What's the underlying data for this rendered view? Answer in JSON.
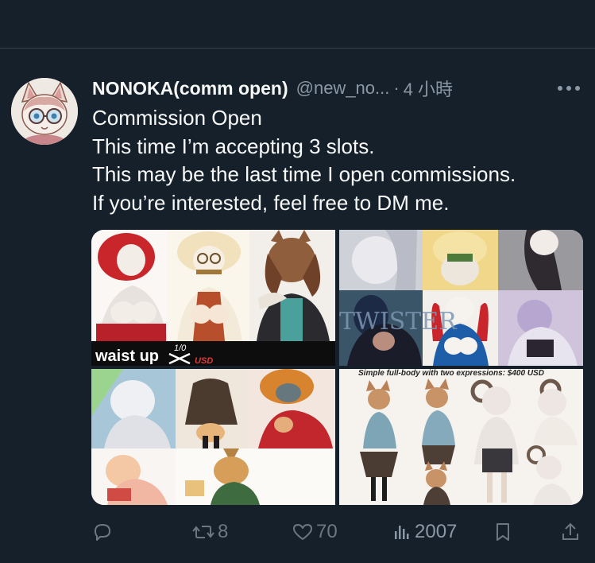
{
  "tweet": {
    "display_name": "NONOKA(comm open)",
    "handle": "@new_no...",
    "separator": "·",
    "time": "4 小時",
    "more_label": "•••",
    "lines": [
      "Commission Open",
      "This time I’m accepting 3 slots.",
      "This may be the last time I open commissions.",
      "If you’re interested, feel free to DM me."
    ]
  },
  "media": {
    "image1_caption": "waist up",
    "image1_price_old": "1/0",
    "image1_price_unit": "USD",
    "image2_banner": "TWISTER",
    "image4_caption": "Simple full-body with two expressions: $400 USD"
  },
  "actions": {
    "reply_count": "",
    "repost_count": "8",
    "like_count": "70",
    "views_count": "2007"
  },
  "colors": {
    "background": "#15202b",
    "text": "#f7f9f9",
    "muted": "#8b98a5",
    "icon": "#6e7781",
    "divider": "#38444d"
  }
}
